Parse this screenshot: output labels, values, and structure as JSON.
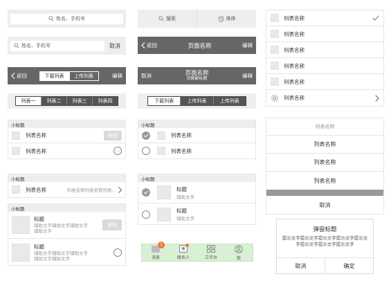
{
  "search_bar_1": {
    "placeholder": "姓名、手机号"
  },
  "search_bar_2": {
    "placeholder": "姓名、手机号",
    "cancel": "取消"
  },
  "nav_1": {
    "back": "返回",
    "tabs": [
      "下载列表",
      "上传列表"
    ],
    "edit": "编辑"
  },
  "tabs_4": [
    "列表一",
    "列表二",
    "列表三",
    "列表四"
  ],
  "section_1": {
    "title": "小标题",
    "rows": [
      {
        "label": "列表名称",
        "button": "按钮"
      },
      {
        "label": "列表名称"
      }
    ]
  },
  "section_2": {
    "title": "小标题",
    "label": "列表名称",
    "value": "列表名称列表名称列表..."
  },
  "section_3": {
    "title": "小标题",
    "cards": [
      {
        "title": "标题",
        "desc": "辅助文字辅助文字辅助文字辅助文字",
        "button": "按钮"
      },
      {
        "title": "标题",
        "desc": "辅助文字辅助文字辅助文字辅助文字辅助文字"
      }
    ]
  },
  "filter_bar": {
    "search": "搜索",
    "sort": "排序"
  },
  "nav_2": {
    "back": "返回",
    "title": "页面名称",
    "edit": "编辑"
  },
  "nav_3": {
    "cancel": "取消",
    "title": "页面名称",
    "subtitle": "页面副标题",
    "edit": "编辑"
  },
  "tabs_3": [
    "下载列表",
    "上传列表",
    "上传列表"
  ],
  "section_4": {
    "title": "小标题",
    "rows": [
      {
        "label": "列表名称"
      },
      {
        "label": "列表名称"
      }
    ]
  },
  "section_5": {
    "title": "小标题",
    "rows": [
      {
        "title": "标题",
        "sub": "辅助文字"
      },
      {
        "title": "标题",
        "sub": "辅助文字"
      }
    ]
  },
  "bottom_nav": [
    {
      "label": "消息",
      "badge": "1"
    },
    {
      "label": "联系人"
    },
    {
      "label": "工作台"
    },
    {
      "label": "我"
    }
  ],
  "right_list": [
    "列表名称",
    "列表名称",
    "列表名称",
    "列表名称",
    "列表名称",
    "列表名称"
  ],
  "action_sheet": {
    "title": "列表名称",
    "items": [
      "列表名称",
      "列表名称",
      "列表名称"
    ],
    "cancel": "取消"
  },
  "dialog": {
    "title": "弹窗标题",
    "text": "提示文字提示文字提示文字提示文字提示文字提示文字提示文字提示文字",
    "cancel": "取消",
    "confirm": "确定"
  },
  "colors": {
    "dark_bar": "#666666",
    "gray_bg": "#eeeeee",
    "bottom_nav_bg": "#d8f0d4",
    "badge": "#ee7b3a"
  }
}
